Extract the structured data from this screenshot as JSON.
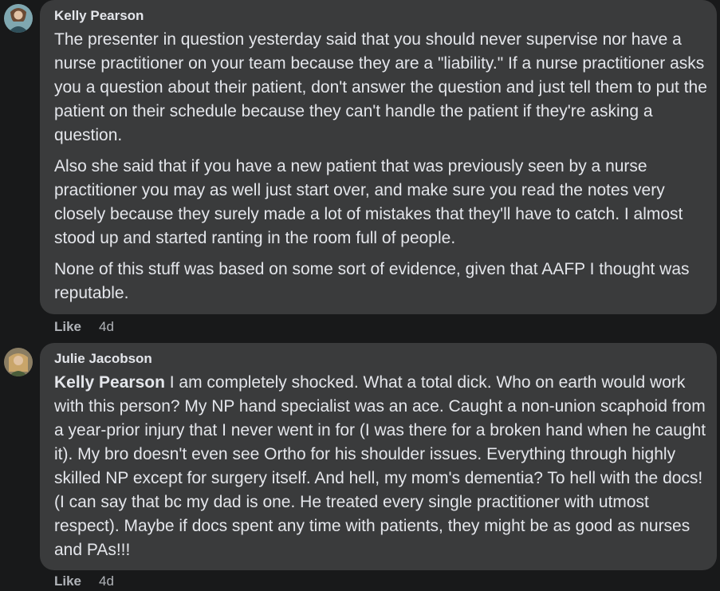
{
  "comments": [
    {
      "author": "Kelly Pearson",
      "paragraphs": [
        "The presenter in question yesterday said that you should never supervise nor have a nurse practitioner on your team because they are a \"liability.\" If a nurse practitioner asks you a question about their patient, don't answer the question and just tell them to put the patient on their schedule because they can't handle the patient if they're asking a question.",
        "Also she said that if you have a new patient that was previously seen by a nurse practitioner you may as well just start over, and make sure you read the notes very closely because they surely made a lot of mistakes that they'll have to catch. I almost stood up and started ranting in the room full of people.",
        "None of this stuff was based on some sort of evidence, given that AAFP I thought was reputable."
      ],
      "like_label": "Like",
      "time": "4d"
    },
    {
      "author": "Julie Jacobson",
      "mention": "Kelly Pearson",
      "text": " I am completely shocked. What a total dick. Who on earth would work with this person? My NP hand specialist was an ace. Caught a non-union scaphoid from a year-prior injury that I never went in for (I was there for a broken hand when he caught it). My bro doesn't even see Ortho for his shoulder issues. Everything through highly skilled NP except for surgery itself. And hell, my mom's dementia? To hell with the docs! (I can say that bc my dad is one. He treated every single practitioner with utmost respect). Maybe if docs spent any time with patients, they might be as good as nurses and PAs!!!",
      "like_label": "Like",
      "time": "4d"
    }
  ]
}
